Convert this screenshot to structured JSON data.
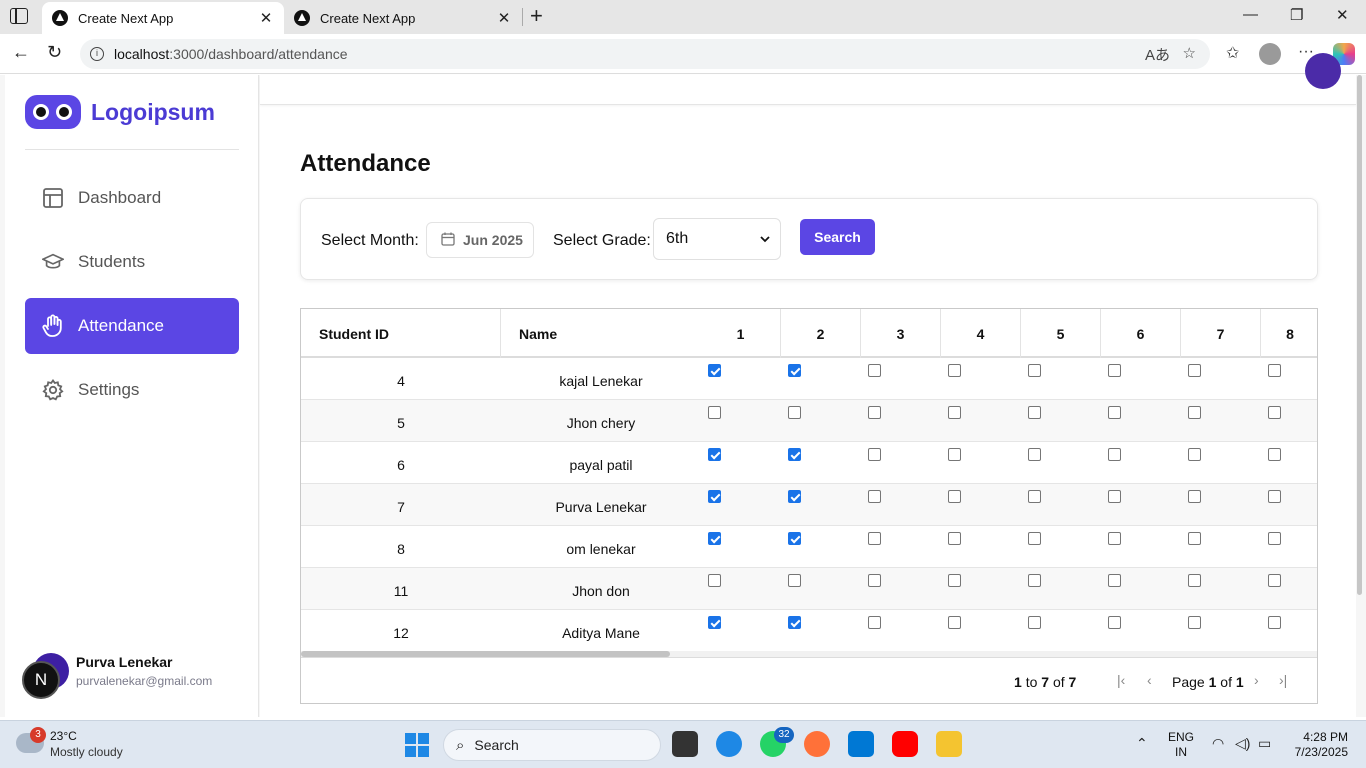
{
  "browser": {
    "tabs": [
      {
        "title": "Create Next App",
        "close": "✕"
      },
      {
        "title": "Create Next App",
        "close": "✕"
      }
    ],
    "new_tab": "+",
    "url_host": "localhost",
    "url_path": ":3000/dashboard/attendance"
  },
  "sidebar": {
    "logo_text": "Logoipsum",
    "items": [
      {
        "label": "Dashboard",
        "icon": "layout-icon",
        "active": false
      },
      {
        "label": "Students",
        "icon": "graduation-cap-icon",
        "active": false
      },
      {
        "label": "Attendance",
        "icon": "hand-icon",
        "active": true
      },
      {
        "label": "Settings",
        "icon": "gear-icon",
        "active": false
      }
    ],
    "user": {
      "name": "Purva Lenekar",
      "email": "purvalenekar@gmail.com",
      "badge": "N"
    }
  },
  "page": {
    "title": "Attendance",
    "filters": {
      "month_label": "Select Month:",
      "month_value": "Jun 2025",
      "grade_label": "Select Grade:",
      "grade_value": "6th",
      "search_label": "Search"
    }
  },
  "grid": {
    "columns": [
      "Student ID",
      "Name",
      "1",
      "2",
      "3",
      "4",
      "5",
      "6",
      "7",
      "8"
    ],
    "rows": [
      {
        "id": "4",
        "name": "kajal Lenekar",
        "days": [
          true,
          true,
          false,
          false,
          false,
          false,
          false,
          false
        ]
      },
      {
        "id": "5",
        "name": "Jhon chery",
        "days": [
          false,
          false,
          false,
          false,
          false,
          false,
          false,
          false
        ]
      },
      {
        "id": "6",
        "name": "payal patil",
        "days": [
          true,
          true,
          false,
          false,
          false,
          false,
          false,
          false
        ]
      },
      {
        "id": "7",
        "name": "Purva Lenekar",
        "days": [
          true,
          true,
          false,
          false,
          false,
          false,
          false,
          false
        ]
      },
      {
        "id": "8",
        "name": "om lenekar",
        "days": [
          true,
          true,
          false,
          false,
          false,
          false,
          false,
          false
        ]
      },
      {
        "id": "11",
        "name": "Jhon don",
        "days": [
          false,
          false,
          false,
          false,
          false,
          false,
          false,
          false
        ]
      },
      {
        "id": "12",
        "name": "Aditya Mane",
        "days": [
          true,
          true,
          false,
          false,
          false,
          false,
          false,
          false
        ]
      }
    ],
    "pagination": {
      "from": "1",
      "to_word": "to",
      "to": "7",
      "of_word": "of",
      "total": "7",
      "page_word": "Page",
      "page": "1",
      "pages": "1"
    }
  },
  "taskbar": {
    "weather_badge": "3",
    "temperature": "23°C",
    "weather": "Mostly cloudy",
    "search_label": "Search",
    "whatsapp_badge": "32",
    "lang_line1": "ENG",
    "lang_line2": "IN",
    "time": "4:28 PM",
    "date": "7/23/2025"
  },
  "colors": {
    "accent": "#5b46e4",
    "checkbox_on": "#1a73e8"
  }
}
